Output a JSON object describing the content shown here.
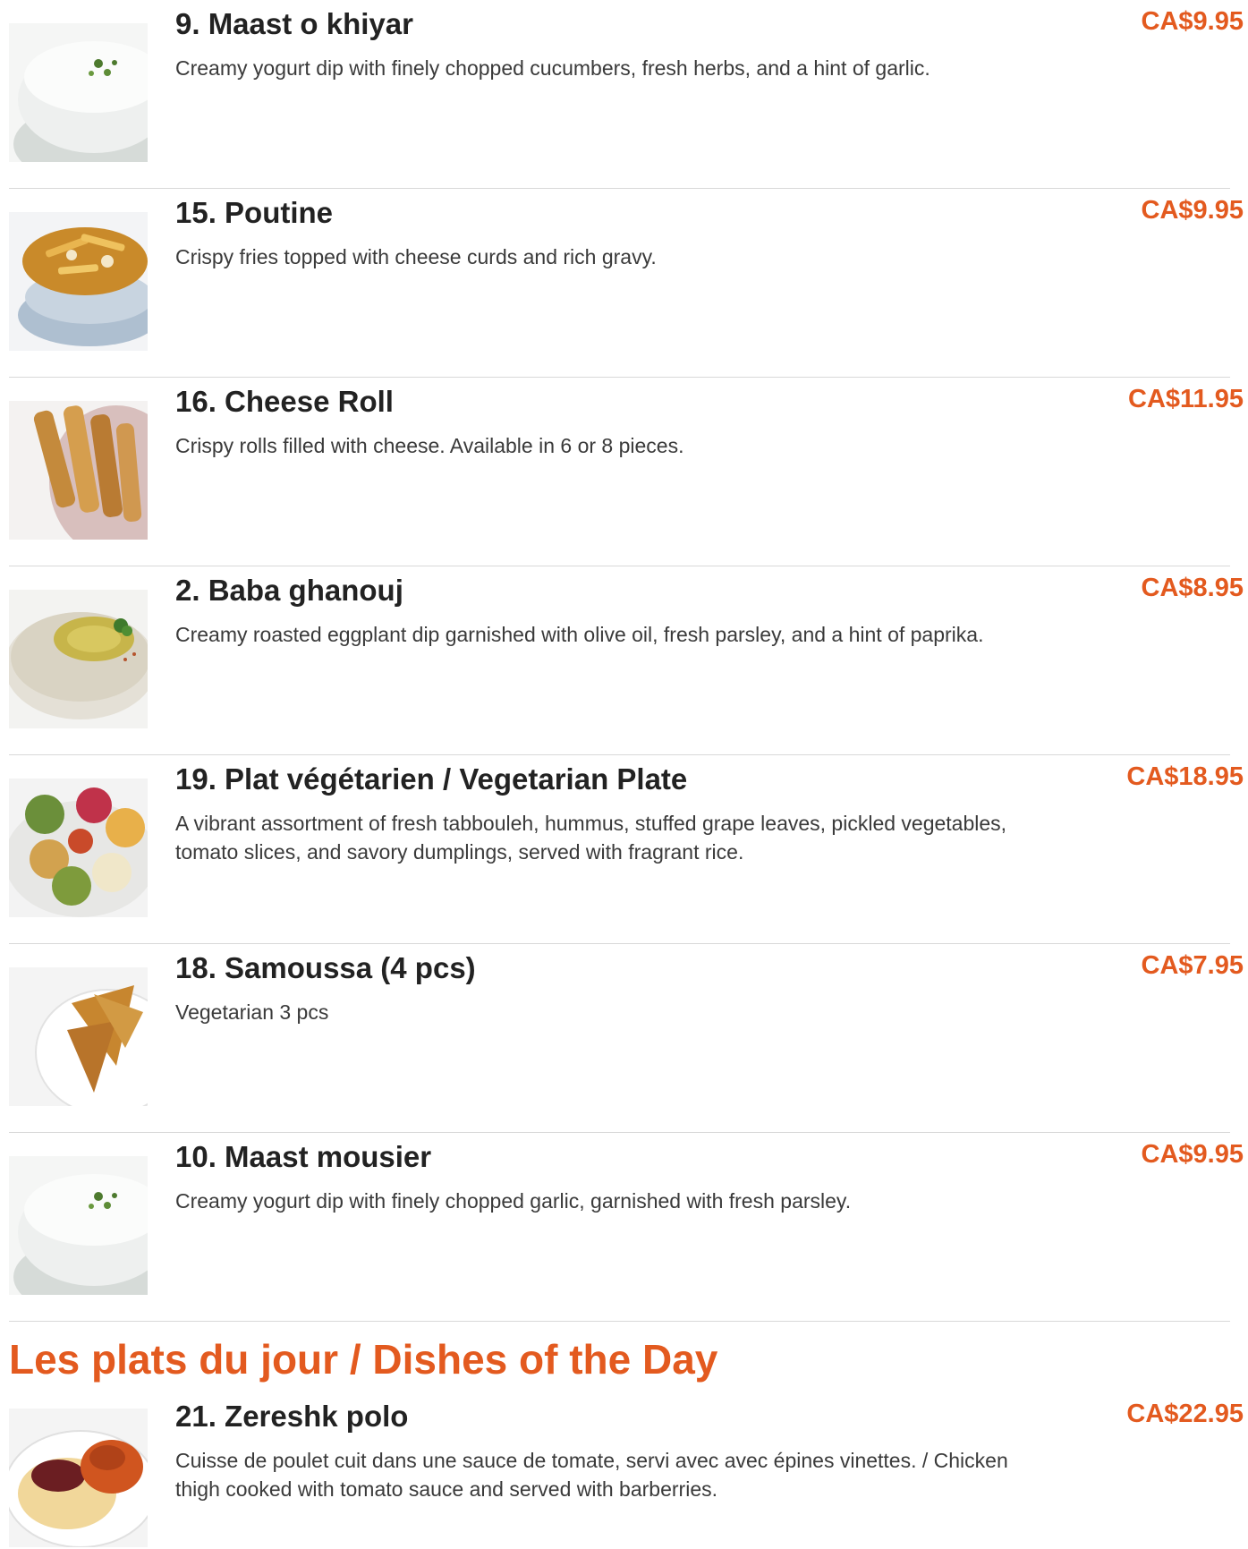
{
  "items": [
    {
      "name": "9. Maast o khiyar",
      "price": "CA$9.95",
      "description": "Creamy yogurt dip with finely chopped cucumbers, fresh herbs, and a hint of garlic.",
      "image": "yogurt-dip-bowl"
    },
    {
      "name": "15. Poutine",
      "price": "CA$9.95",
      "description": "Crispy fries topped with cheese curds and rich gravy.",
      "image": "poutine-bowl"
    },
    {
      "name": "16. Cheese Roll",
      "price": "CA$11.95",
      "description": "Crispy rolls filled with cheese. Available in 6 or 8 pieces.",
      "image": "cheese-rolls-plate"
    },
    {
      "name": "2. Baba ghanouj",
      "price": "CA$8.95",
      "description": "Creamy roasted eggplant dip garnished with olive oil, fresh parsley, and a hint of paprika.",
      "image": "eggplant-dip-plate"
    },
    {
      "name": "19. Plat végétarien / Vegetarian Plate",
      "price": "CA$18.95",
      "description": "A vibrant assortment of fresh tabbouleh, hummus, stuffed grape leaves, pickled vegetables, tomato slices, and savory dumplings, served with fragrant rice.",
      "image": "vegetarian-platter"
    },
    {
      "name": "18. Samoussa (4 pcs)",
      "price": "CA$7.95",
      "description": "Vegetarian 3 pcs",
      "image": "samosa-plate"
    },
    {
      "name": "10. Maast mousier",
      "price": "CA$9.95",
      "description": "Creamy yogurt dip with finely chopped garlic, garnished with fresh parsley.",
      "image": "yogurt-dip-bowl"
    }
  ],
  "section": {
    "title": "Les plats du jour / Dishes of the Day"
  },
  "section_items": [
    {
      "name": "21. Zereshk polo",
      "price": "CA$22.95",
      "description": "Cuisse de poulet cuit dans une sauce de tomate, servi avec avec épines vinettes. / Chicken thigh cooked with tomato sauce and served with barberries.",
      "image": "zereshk-polo-plate"
    }
  ],
  "colors": {
    "accent": "#e35a1f",
    "divider": "#d8d8d8",
    "heading": "#222222",
    "text": "#3a3a3a"
  }
}
